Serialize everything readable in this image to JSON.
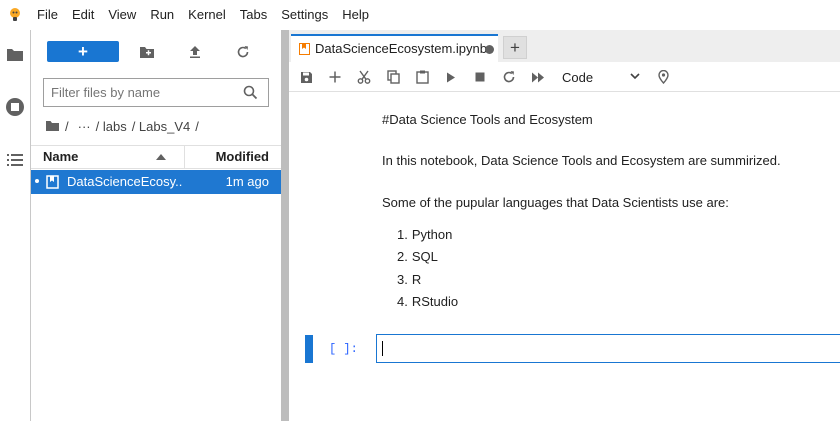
{
  "menubar": {
    "items": [
      "File",
      "Edit",
      "View",
      "Run",
      "Kernel",
      "Tabs",
      "Settings",
      "Help"
    ]
  },
  "rail": {
    "icons": [
      "folder-icon",
      "running-icon",
      "table-of-contents-icon"
    ]
  },
  "filebrowser": {
    "new_label": "+",
    "tools": [
      "new-folder-icon",
      "upload-icon",
      "refresh-icon"
    ],
    "filter_placeholder": "Filter files by name",
    "breadcrumbs": [
      "/",
      "···",
      "/ labs",
      "/ Labs_V4",
      "/"
    ],
    "columns": {
      "name": "Name",
      "modified": "Modified"
    },
    "files": [
      {
        "name": "DataScienceEcosy...",
        "modified": "1m ago",
        "selected": true,
        "running": true
      }
    ]
  },
  "tabbar": {
    "tab_label": "DataScienceEcosystem.ipynb",
    "new_tab": "+"
  },
  "toolbar": {
    "icons": [
      "save-icon",
      "add-cell-icon",
      "cut-icon",
      "copy-icon",
      "paste-icon",
      "run-icon",
      "stop-icon",
      "restart-icon",
      "run-all-icon"
    ],
    "cell_type": "Code"
  },
  "notebook": {
    "heading": "#Data Science Tools and Ecosystem",
    "intro": "In this notebook, Data Science Tools and Ecosystem are summirized.",
    "languages_intro": "Some of the pupular languages that Data Scientists use are:",
    "languages": [
      "Python",
      "SQL",
      "R",
      "RStudio"
    ],
    "code_prompt": "[ ]:"
  },
  "colors": {
    "accent": "#1976d2",
    "selected_row": "#1f78d1",
    "splitter": "#bdbdbd",
    "prompt": "#2962ff"
  }
}
